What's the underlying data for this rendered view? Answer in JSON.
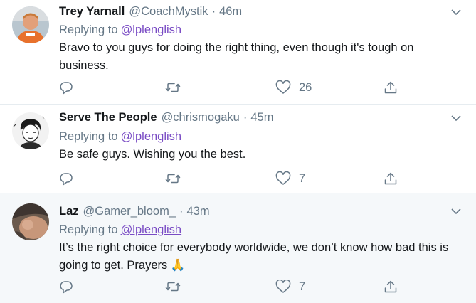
{
  "tweets": [
    {
      "display_name": "Trey Yarnall",
      "handle": "@CoachMystik",
      "separator": "·",
      "time": "46m",
      "replying_label": "Replying to",
      "replying_to": "@lplenglish",
      "text": "Bravo to you guys for doing the right thing, even though it's tough on business.",
      "reply_count": "",
      "retweet_count": "",
      "like_count": "26"
    },
    {
      "display_name": "Serve The People",
      "handle": "@chrismogaku",
      "separator": "·",
      "time": "45m",
      "replying_label": "Replying to",
      "replying_to": "@lplenglish",
      "text": "Be safe guys. Wishing you the best.",
      "reply_count": "",
      "retweet_count": "",
      "like_count": "7"
    },
    {
      "display_name": "Laz",
      "handle": "@Gamer_bloom_",
      "separator": "·",
      "time": "43m",
      "replying_label": "Replying to",
      "replying_to": "@lplenglish",
      "text": "It’s the right choice for everybody worldwide, we don’t know how bad this is going to get. Prayers 🙏",
      "reply_count": "",
      "retweet_count": "",
      "like_count": "7"
    }
  ],
  "colors": {
    "text_primary": "#14171a",
    "text_secondary": "#657786",
    "mention": "#794bc4",
    "divider": "#e6ecf0",
    "hover_bg": "#f5f8fa"
  },
  "icons": {
    "reply": "reply-icon",
    "retweet": "retweet-icon",
    "like": "heart-icon",
    "share": "share-icon",
    "more": "chevron-down-icon"
  }
}
